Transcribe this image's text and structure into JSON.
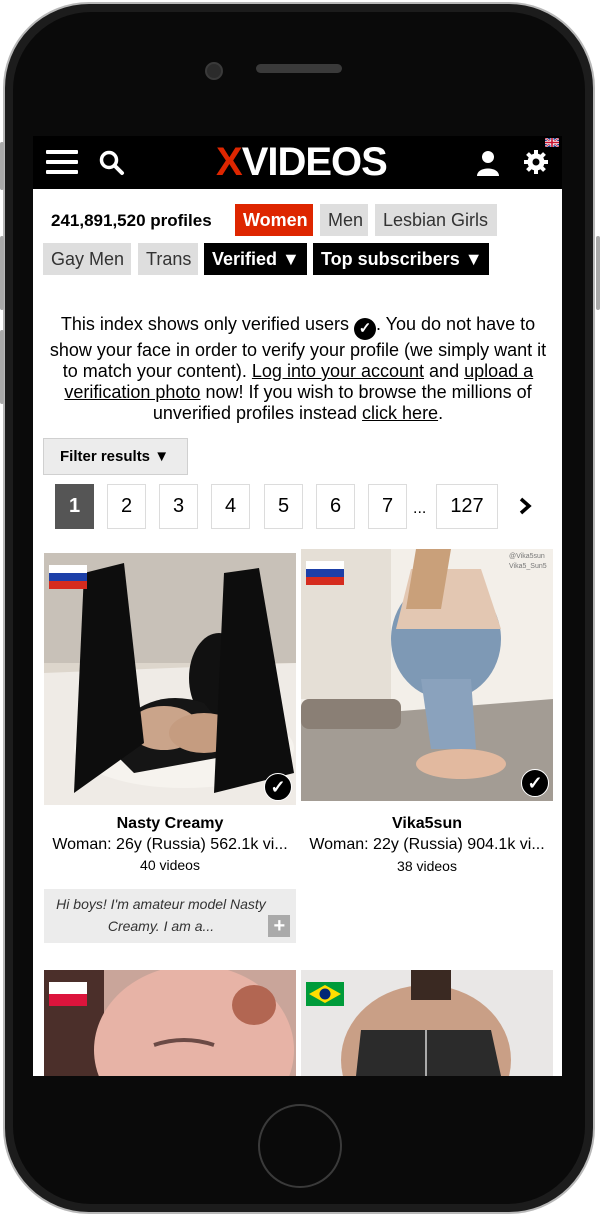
{
  "header": {
    "logo_x": "X",
    "logo_rest": "VIDEOS",
    "icons": [
      "menu-icon",
      "search-icon",
      "user-icon",
      "gear-icon",
      "uk-flag-icon"
    ]
  },
  "filters": {
    "profile_count": "241,891,520 profiles",
    "chips": {
      "women": "Women",
      "men": "Men",
      "lesbian": "Lesbian Girls",
      "gay": "Gay Men",
      "trans": "Trans",
      "verified": "Verified ▼",
      "top_subscribers": "Top subscribers ▼"
    }
  },
  "notice": {
    "part1": "This index shows only verified users",
    "part2": ". You do not have to show your face in order to verify your profile (we simply want it to match your content).",
    "link_login": "Log into your account",
    "and": "and",
    "link_upload": "upload a verification photo",
    "part3": "now! If you wish to browse the millions of unverified profiles instead",
    "link_click": "click here",
    "end": "."
  },
  "filter_button": "Filter results ▼",
  "pagination": {
    "pages": [
      "1",
      "2",
      "3",
      "4",
      "5",
      "6",
      "7"
    ],
    "ellipsis": "...",
    "last": "127",
    "current": "1"
  },
  "colors": {
    "brand_red": "#de2600",
    "topbar": "#000000",
    "chip_bg": "#dedede"
  },
  "profiles": [
    {
      "name": "Nasty Creamy",
      "meta": "Woman: 26y (Russia) 562.1k vi...",
      "videos": "40 videos",
      "bio": "Hi boys! I'm amateur model Nasty Creamy. I am a...",
      "flag": "russia",
      "verified_mark": "✓"
    },
    {
      "name": "Vika5sun",
      "meta": "Woman: 22y (Russia) 904.1k vi...",
      "videos": "38 videos",
      "flag": "russia",
      "watermark1": "@Vika5sun",
      "watermark2": "Vika5_Sun5",
      "verified_mark": "✓"
    },
    {
      "flag": "poland"
    },
    {
      "flag": "brazil"
    }
  ]
}
